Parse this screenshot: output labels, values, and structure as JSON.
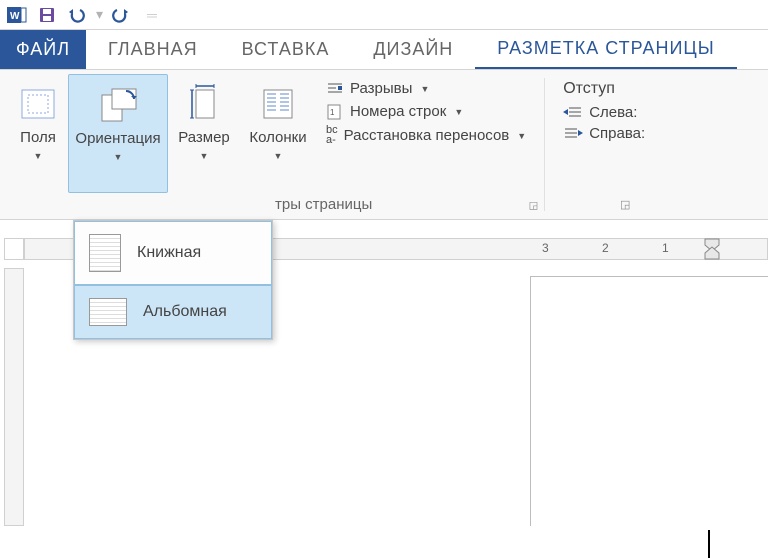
{
  "qat": {
    "word_icon": "word-app-icon",
    "save_icon": "save-icon",
    "undo_icon": "undo-icon",
    "redo_icon": "redo-icon",
    "customize_icon": "customize-qat-icon"
  },
  "tabs": {
    "file": "ФАЙЛ",
    "home": "ГЛАВНАЯ",
    "insert": "ВСТАВКА",
    "design": "ДИЗАЙН",
    "page_layout": "РАЗМЕТКА СТРАНИЦЫ"
  },
  "ribbon": {
    "margins": "Поля",
    "orientation": "Ориентация",
    "size": "Размер",
    "columns": "Колонки",
    "breaks": "Разрывы",
    "line_numbers": "Номера строк",
    "hyphenation": "Расстановка переносов",
    "group_page_setup_partial": "тры страницы",
    "indent_header": "Отступ",
    "indent_left": "Слева:",
    "indent_right": "Справа:",
    "hyph_prefix": "bc",
    "hyph_prefix2": "a-"
  },
  "orientation_menu": {
    "portrait": "Книжная",
    "landscape": "Альбомная"
  },
  "ruler": {
    "n3": "3",
    "n2": "2",
    "n1": "1"
  }
}
